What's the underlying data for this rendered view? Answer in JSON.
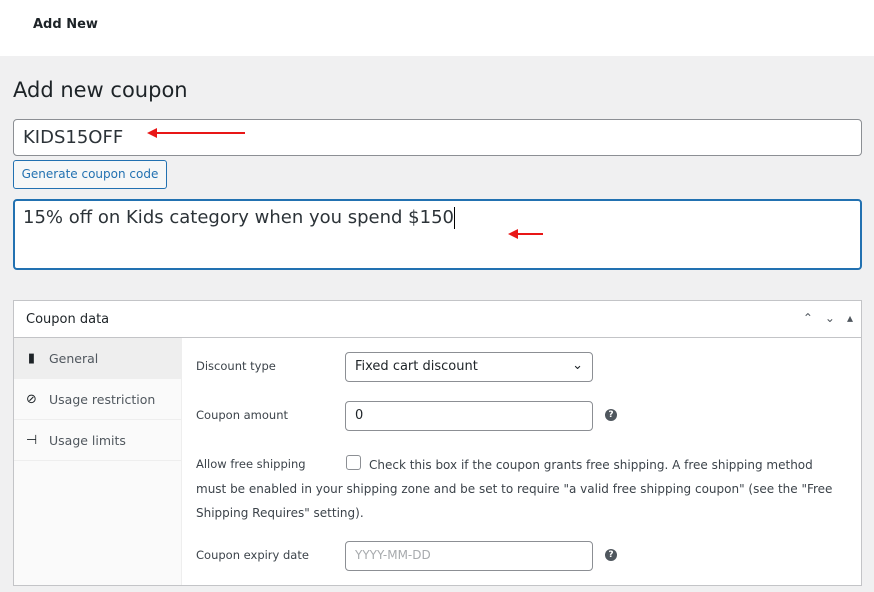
{
  "topbar": {
    "add_new": "Add New"
  },
  "page": {
    "title": "Add new coupon"
  },
  "coupon_code": {
    "value": "KIDS15OFF"
  },
  "generate_button": "Generate coupon code",
  "description": {
    "value": "15% off on Kids category when you spend $150"
  },
  "annotation_color": "#e81717",
  "panel": {
    "title": "Coupon data",
    "tabs": [
      {
        "label": "General",
        "icon": "ticket-icon"
      },
      {
        "label": "Usage restriction",
        "icon": "prohibited-icon"
      },
      {
        "label": "Usage limits",
        "icon": "limits-icon"
      }
    ],
    "fields": {
      "discount_type": {
        "label": "Discount type",
        "value": "Fixed cart discount"
      },
      "coupon_amount": {
        "label": "Coupon amount",
        "value": "0"
      },
      "free_shipping": {
        "label": "Allow free shipping",
        "text": "Check this box if the coupon grants free shipping. A free shipping method must be enabled in your shipping zone and be set to require \"a valid free shipping coupon\" (see the \"Free Shipping Requires\" setting).",
        "checked": false
      },
      "expiry": {
        "label": "Coupon expiry date",
        "placeholder": "YYYY-MM-DD"
      }
    }
  }
}
